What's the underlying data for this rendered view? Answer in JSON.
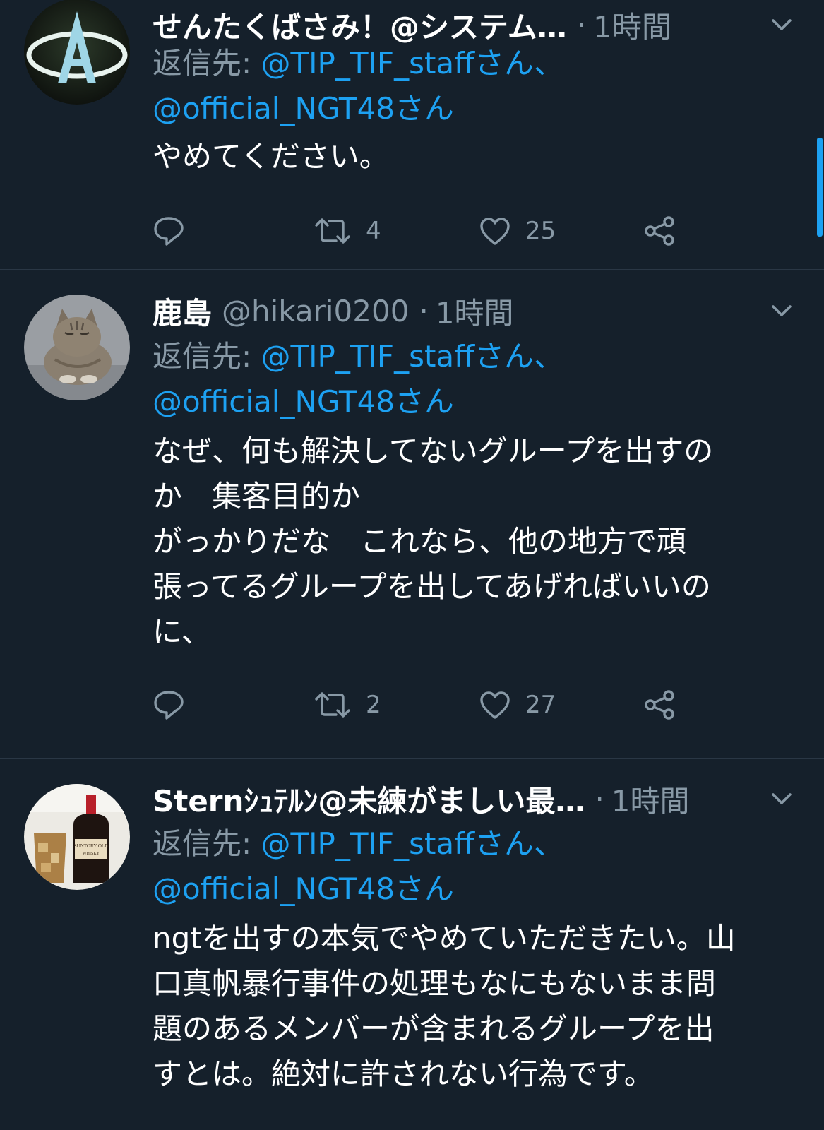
{
  "tweets": [
    {
      "name": "せんたくばさみ！@システム…",
      "handle": "",
      "time": "1時間",
      "reply_label": "返信先: ",
      "reply_mention_1": "@TIP_TIF_staffさん、",
      "reply_mention_2": "@official_NGT48さん",
      "text": "やめてください。",
      "retweets": "4",
      "likes": "25"
    },
    {
      "name": "鹿島",
      "handle": "@hikari0200",
      "time": "1時間",
      "reply_label": "返信先: ",
      "reply_mention_1": "@TIP_TIF_staffさん、",
      "reply_mention_2": "@official_NGT48さん",
      "text": "なぜ、何も解決してないグループを出すの\nか　集客目的か\nがっかりだな　これなら、他の地方で頑\n張ってるグループを出してあげればいいの\nに、",
      "retweets": "2",
      "likes": "27"
    },
    {
      "name": "Sternｼｭﾃﾙﾝ@未練がましい最…",
      "handle": "",
      "time": "1時間",
      "reply_label": "返信先: ",
      "reply_mention_1": "@TIP_TIF_staffさん、",
      "reply_mention_2": "@official_NGT48さん",
      "text": "ngtを出すの本気でやめていただきたい。山\n口真帆暴行事件の処理もなにもないまま問\n題のあるメンバーが含まれるグループを出\nすとは。絶対に許されない行為です。"
    }
  ],
  "colors": {
    "background": "#15202b",
    "accent": "#1da1f2",
    "secondary_text": "#8899a6",
    "divider": "#2a3745"
  },
  "icons": [
    "reply-icon",
    "retweet-icon",
    "like-icon",
    "share-icon",
    "chevron-down-icon"
  ]
}
